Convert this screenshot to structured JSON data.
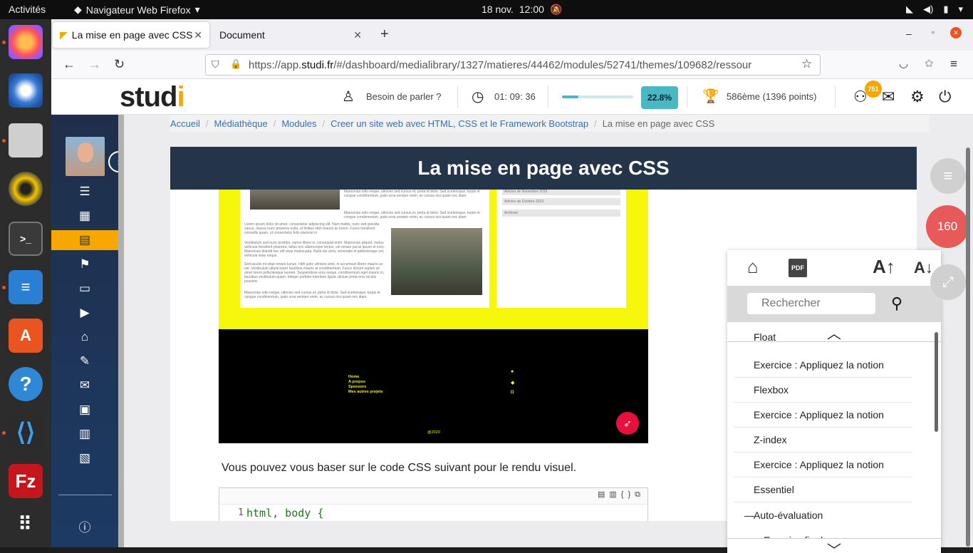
{
  "topbar": {
    "activities": "Activités",
    "app_name": "Navigateur Web Firefox",
    "date": "18 nov.",
    "time": "12:00"
  },
  "browser": {
    "tabs": [
      {
        "label": "La mise en page avec CSS",
        "active": true
      },
      {
        "label": "Document",
        "active": false
      }
    ],
    "url_prefix": "https://app.",
    "url_domain": "studi.fr",
    "url_path": "/#/dashboard/medialibrary/1327/matieres/44462/modules/52741/themes/109682/ressour"
  },
  "header": {
    "logo_main": "stud",
    "logo_accent": "i",
    "help_label": "Besoin de parler ?",
    "timer": "01: 09: 36",
    "progress_percent": 22.8,
    "progress_label": "22.8%",
    "ranking": "586ème (1396 points)",
    "notifications": "751"
  },
  "breadcrumb": [
    "Accueil",
    "Médiathèque",
    "Modules",
    "Creer un site web avec HTML, CSS et le Framework Bootstrap",
    "La mise en page avec CSS"
  ],
  "lesson": {
    "title": "La mise en page avec CSS",
    "body_text": "Vous pouvez vous baser sur le code CSS suivant pour le rendu visuel.",
    "code_line_number": "1",
    "code_selector": "html, body {",
    "preview": {
      "archive_links": [
        "Articles de Novembre 2019",
        "Articles de Octobre 2019",
        "Archives"
      ],
      "footer_links": [
        "Home",
        "A propos",
        "Sponsors",
        "Mes autres projets"
      ],
      "copyright": "@2020",
      "paragraphs": [
        "Maecenas odio neque, ultricies sed cursus et, porta id dolor. Sed scelerisque, turpis et congue condimentum, justo urna semper enim, ac cursus nisi quam nec diam.",
        "Lorem ipsum dolor sit amet, consectetur adipiscing elit. Nam mattis, nunc sed gravida varius, massa nunc pharetra nulla, ut finibus nibh mauris ac lorem. Fusce hendrerit convallis quam, ut consectetur felis placerat in.",
        "Vestibulum sed nunc porttitor, varius libero in, consequat enim. Maecenas aliquet, metus vehicula hendrerit pharetra, tellus orci ullamcorper lectus, vel ornare purus ipsum et eros. Maecenas blandit nec elit vitae malesuada. Nulla dui urna, venenatis id pellentesque vel, vehicula vitae neque.",
        "Sed iaculis mi vitae ornare luctus. nibh justo ultricies ante, in accumsan libero mauris ac est. Vestibulum ullamcorper faucibus mauris at condimentum. Fusce dictum sapien sit amet lorem pellentesque laoreet. Suspendisse eros neque, condimentum eget mauris in, faucibus vestibulum quam. Integer porttitor interdum ligula, dictum porta eros iaculis posuere.",
        "Maecenas odio neque, ultricies sed cursus et, porta id dolor. Sed scelerisque, turpis et congue condimentum, justo urna semper enim, ac cursus nisi quam nec diam."
      ]
    }
  },
  "toc": {
    "search_placeholder": "Rechercher",
    "partial_top": "Float",
    "items": [
      {
        "label": "Exercice : Appliquez la notion"
      },
      {
        "label": "Flexbox"
      },
      {
        "label": "Exercice : Appliquez la notion"
      },
      {
        "label": "Z-index"
      },
      {
        "label": "Exercice : Appliquez la notion"
      },
      {
        "label": "Essentiel"
      },
      {
        "label": "Auto-évaluation",
        "expanded": true
      },
      {
        "label": "Exercice final"
      }
    ]
  },
  "floating": {
    "counter": "160"
  },
  "colors": {
    "accent": "#f6a800",
    "header_dark": "#243449",
    "progress": "#49b8c2",
    "counter_bg": "#e85a5a"
  }
}
